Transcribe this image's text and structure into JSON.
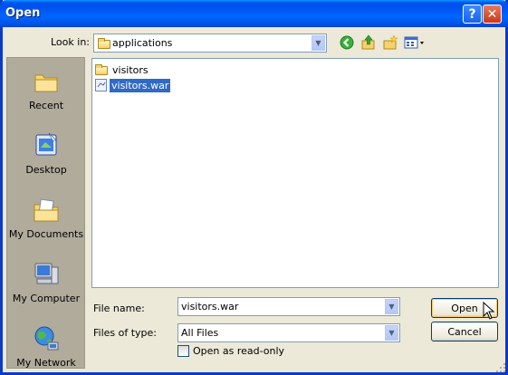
{
  "window": {
    "title": "Open",
    "help_label": "?",
    "close_label": "✕"
  },
  "toolbar": {
    "look_in_label": "Look in:",
    "look_in_value": "applications",
    "tools": [
      "back-icon",
      "up-folder-icon",
      "new-folder-icon",
      "view-menu-icon"
    ]
  },
  "places": [
    {
      "label": "Recent",
      "icon": "recent-folder-icon"
    },
    {
      "label": "Desktop",
      "icon": "desktop-icon"
    },
    {
      "label": "My Documents",
      "icon": "my-documents-icon"
    },
    {
      "label": "My Computer",
      "icon": "my-computer-icon"
    },
    {
      "label": "My Network",
      "icon": "my-network-icon"
    }
  ],
  "files": [
    {
      "name": "visitors",
      "type": "folder",
      "selected": false
    },
    {
      "name": "visitors.war",
      "type": "war",
      "selected": true
    }
  ],
  "form": {
    "file_name_label": "File name:",
    "file_name_value": "visitors.war",
    "file_type_label": "Files of type:",
    "file_type_value": "All Files",
    "readonly_label": "Open as read-only",
    "readonly_checked": false
  },
  "buttons": {
    "open": "Open",
    "cancel": "Cancel"
  },
  "colors": {
    "title_blue": "#0053ee",
    "selection": "#316ac5",
    "dialog_bg": "#ece9d8"
  }
}
